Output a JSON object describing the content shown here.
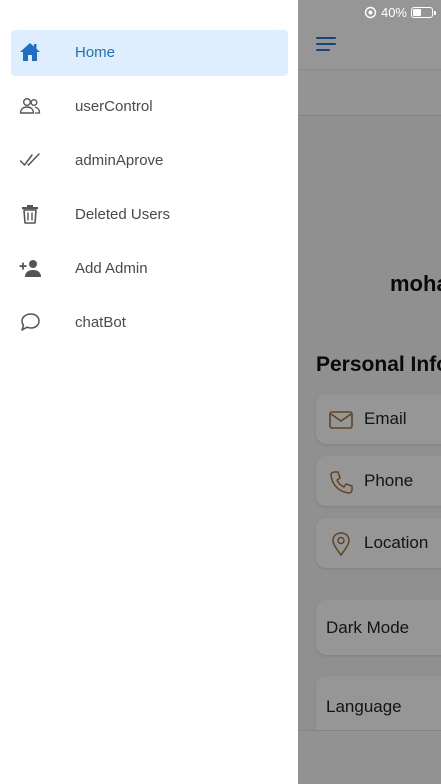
{
  "status_bar": {
    "battery_text": "40%",
    "battery_level": 0.4
  },
  "drawer": {
    "items": [
      {
        "label": "Home",
        "icon": "home-icon",
        "active": true
      },
      {
        "label": "userControl",
        "icon": "users-icon",
        "active": false
      },
      {
        "label": "adminAprove",
        "icon": "double-check-icon",
        "active": false
      },
      {
        "label": "Deleted Users",
        "icon": "trash-icon",
        "active": false
      },
      {
        "label": "Add Admin",
        "icon": "person-add-icon",
        "active": false
      },
      {
        "label": "chatBot",
        "icon": "chat-bubble-icon",
        "active": false
      }
    ]
  },
  "profile": {
    "username": "moha",
    "section_title": "Personal Info",
    "info": [
      {
        "label": "Email",
        "icon": "mail-icon"
      },
      {
        "label": "Phone",
        "icon": "phone-icon"
      },
      {
        "label": "Location",
        "icon": "location-pin-icon"
      }
    ],
    "settings": [
      {
        "label": "Dark Mode"
      },
      {
        "label": "Language"
      }
    ]
  },
  "colors": {
    "accent": "#1f6fc5",
    "active_bg": "#dfeeff",
    "icon_brown": "#a0703c",
    "menu_blue": "#2a6fd6"
  }
}
